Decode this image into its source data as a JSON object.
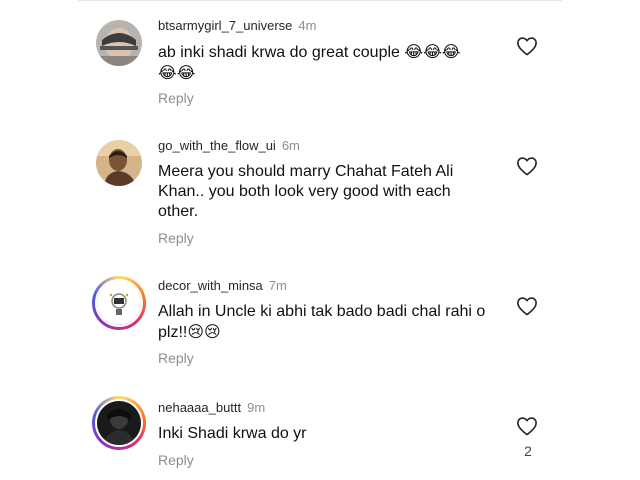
{
  "comments": [
    {
      "username": "btsarmygirl_7_universe",
      "time": "4m",
      "text": "ab inki shadi krwa do great couple 😂😂😂 😂😂",
      "reply": "Reply",
      "avatar": "avatar-gray-hat",
      "like_icon": "heart-outline-icon"
    },
    {
      "username": "go_with_the_flow_ui",
      "time": "6m",
      "text": "Meera you should marry Chahat Fateh Ali Khan.. you both look very good with each other.",
      "reply": "Reply",
      "avatar": "avatar-man-outdoor",
      "like_icon": "heart-outline-icon"
    },
    {
      "username": "decor_with_minsa",
      "time": "7m",
      "text": "Allah in Uncle ki abhi tak bado badi chal rahi o plz!!😢😢",
      "reply": "Reply",
      "avatar": "avatar-story-ring-logo",
      "like_icon": "heart-outline-icon"
    },
    {
      "username": "nehaaaa_buttt",
      "time": "9m",
      "text": "Inki Shadi krwa do yr",
      "reply": "Reply",
      "avatar": "avatar-story-ring-dark",
      "like_icon": "heart-outline-icon",
      "like_count": "2"
    }
  ]
}
